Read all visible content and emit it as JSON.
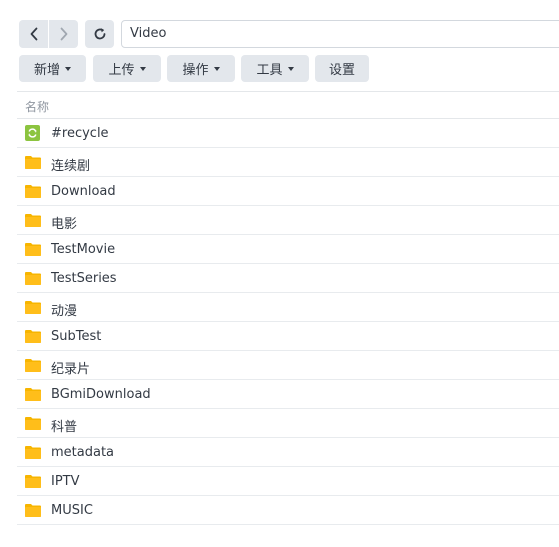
{
  "navigation": {
    "back_icon": "chevron-left-icon",
    "forward_icon": "chevron-right-icon",
    "refresh_icon": "refresh-icon",
    "path": "Video"
  },
  "toolbar": {
    "create_label": "新增",
    "upload_label": "上传",
    "action_label": "操作",
    "tools_label": "工具",
    "settings_label": "设置"
  },
  "list": {
    "column_name": "名称",
    "items": [
      {
        "name": "#recycle",
        "icon": "recycle-bin-icon"
      },
      {
        "name": "连续剧",
        "icon": "folder-icon"
      },
      {
        "name": "Download",
        "icon": "folder-icon"
      },
      {
        "name": "电影",
        "icon": "folder-icon"
      },
      {
        "name": "TestMovie",
        "icon": "folder-icon"
      },
      {
        "name": "TestSeries",
        "icon": "folder-icon"
      },
      {
        "name": "动漫",
        "icon": "folder-icon"
      },
      {
        "name": "SubTest",
        "icon": "folder-icon"
      },
      {
        "name": "纪录片",
        "icon": "folder-icon"
      },
      {
        "name": "BGmiDownload",
        "icon": "folder-icon"
      },
      {
        "name": "科普",
        "icon": "folder-icon"
      },
      {
        "name": "metadata",
        "icon": "folder-icon"
      },
      {
        "name": "IPTV",
        "icon": "folder-icon"
      },
      {
        "name": "MUSIC",
        "icon": "folder-icon"
      }
    ]
  },
  "colors": {
    "folder": "#f7b500",
    "recycle": "#8cc43f",
    "button_bg": "#e3e7ec"
  }
}
